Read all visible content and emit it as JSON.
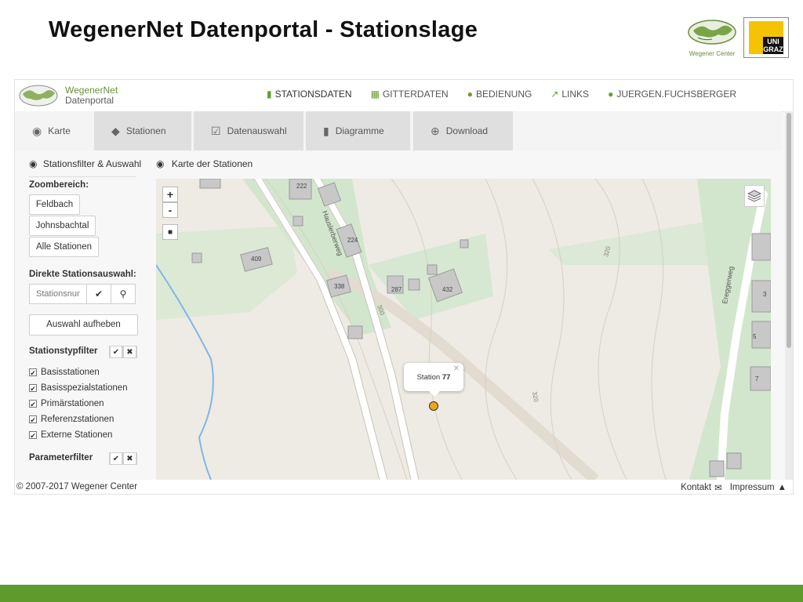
{
  "slide": {
    "title": "WegenerNet Datenportal - Stationslage",
    "logo_wc_caption": "Wegener Center",
    "logo_uni_text": "UNI GRAZ"
  },
  "header": {
    "brand_line1": "WegenerNet",
    "brand_line2": "Datenportal",
    "nav": [
      {
        "label": "STATIONSDATEN",
        "icon": "bar-chart-icon"
      },
      {
        "label": "GITTERDATEN",
        "icon": "grid-icon"
      },
      {
        "label": "BEDIENUNG",
        "icon": "info-icon"
      },
      {
        "label": "LINKS",
        "icon": "external-link-icon"
      },
      {
        "label": "JUERGEN.FUCHSBERGER",
        "icon": "user-icon"
      }
    ]
  },
  "tabs": [
    {
      "label": "Karte",
      "icon": "globe-icon"
    },
    {
      "label": "Stationen",
      "icon": "tags-icon"
    },
    {
      "label": "Datenauswahl",
      "icon": "checkbox-icon"
    },
    {
      "label": "Diagramme",
      "icon": "bar-chart-icon"
    },
    {
      "label": "Download",
      "icon": "download-icon"
    }
  ],
  "sidebar": {
    "title": "Stationsfilter & Auswahl",
    "zoom_label": "Zoombereich:",
    "zoom_buttons": [
      "Feldbach",
      "Johnsbachtal",
      "Alle Stationen"
    ],
    "direct_label": "Direkte Stationsauswahl:",
    "station_placeholder": "Stationsnummer",
    "clear_button": "Auswahl aufheben",
    "type_filter_label": "Stationstypfilter",
    "type_filters": [
      "Basisstationen",
      "Basisspezialstationen",
      "Primärstationen",
      "Referenzstationen",
      "Externe Stationen"
    ],
    "param_filter_label": "Parameterfilter"
  },
  "map": {
    "title": "Karte der Stationen",
    "zoom_in": "+",
    "zoom_out": "-",
    "fullscreen": "■",
    "popup_prefix": "Station",
    "popup_number": "77",
    "road_labels": [
      "Hauslerberweg",
      "Ereggerweg"
    ],
    "contour_labels": [
      "300",
      "320",
      "320"
    ],
    "building_labels": [
      "222",
      "224",
      "409",
      "338",
      "287",
      "432",
      "3",
      "5",
      "7"
    ],
    "colors": {
      "green_area": "#cfe6cc",
      "road": "#ffffff",
      "stream": "#7fb6e6",
      "marker": "#f0a419"
    }
  },
  "footer": {
    "copyright": "© 2007-2017 Wegener Center",
    "contact": "Kontakt",
    "imprint": "Impressum"
  },
  "colors": {
    "accent_green": "#6a9c2f",
    "bottom_bar": "#5f9a2d"
  }
}
